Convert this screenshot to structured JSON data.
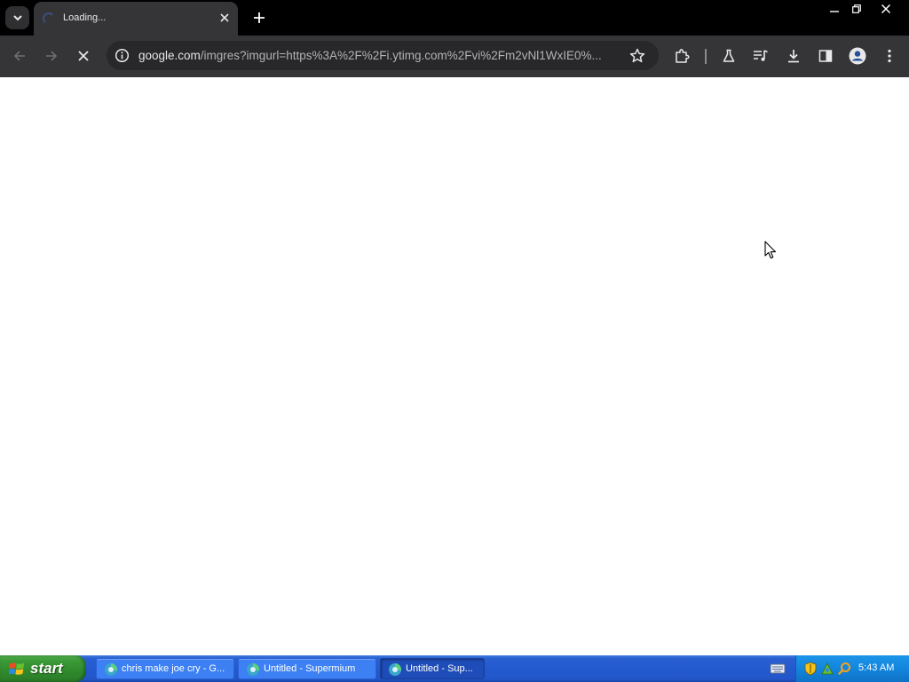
{
  "browser": {
    "tab": {
      "title": "Loading..."
    },
    "address_bar": {
      "url_host": "google.com",
      "url_rest": "/imgres?imgurl=https%3A%2F%2Fi.ytimg.com%2Fvi%2Fm2vNl1WxIE0%..."
    },
    "icons": {
      "tab_search": "chevron-down-icon",
      "tab_close": "close-icon",
      "new_tab": "plus-icon",
      "back": "arrow-left-icon",
      "forward": "arrow-right-icon",
      "stop": "close-icon",
      "site_info": "info-icon",
      "bookmark": "star-icon",
      "extensions": "puzzle-icon",
      "labs": "flask-icon",
      "media": "media-queue-icon",
      "downloads": "download-icon",
      "side_panel": "side-panel-icon",
      "profile": "avatar-icon",
      "menu": "kebab-menu-icon"
    }
  },
  "taskbar": {
    "start_label": "start",
    "items": [
      {
        "label": "chris make joe cry - G..."
      },
      {
        "label": "Untitled - Supermium"
      },
      {
        "label": "Untitled - Sup..."
      }
    ],
    "clock": "5:43 AM"
  },
  "colors": {
    "titlebar": "#000000",
    "toolbar": "#353538",
    "omnibox": "#28282a",
    "taskbar": "#245ad0",
    "start_button": "#3c9a38",
    "tray": "#1385dd"
  }
}
